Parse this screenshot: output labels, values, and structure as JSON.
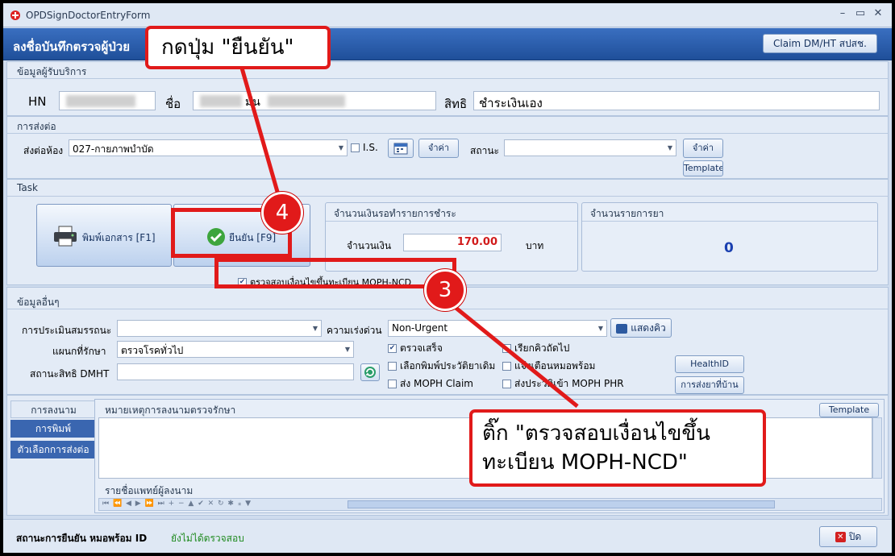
{
  "window": {
    "title": "OPDSignDoctorEntryForm",
    "controls": {
      "minimize": "–",
      "maximize": "▭",
      "close": "✕"
    }
  },
  "header": {
    "title": "ลงชื่อบันทึกตรวจผู้ป่วย",
    "claim_button": "Claim DM/HT สปสช."
  },
  "patient": {
    "section_title": "ข้อมูลผู้รับบริการ",
    "hn_label": "HN",
    "name_label": "ชื่อ",
    "name_value": "มัน",
    "right_label": "สิทธิ",
    "right_value": "ชำระเงินเอง"
  },
  "referral": {
    "section_title": "การส่งต่อ",
    "room_label": "ส่งต่อห้อง",
    "room_value": "027-กายภาพบำบัด",
    "is_label": "I.S.",
    "remember_button": "จำค่า",
    "status_label": "สถานะ",
    "status_value": "",
    "remember_button2": "จำค่า",
    "template_button": "Template"
  },
  "task": {
    "section_title": "Task",
    "print_button": "พิมพ์เอกสาร [F1]",
    "confirm_button": "ยืนยัน [F9]",
    "ncd_checkbox": "ตรวจสอบเงื่อนไขขึ้นทะเบียน MOPH-NCD",
    "ncd_checked": true,
    "payment_panel_title": "จำนวนเงินรอทำรายการชำระ",
    "amount_label": "จำนวนเงิน",
    "amount_value": "170.00",
    "currency": "บาท",
    "drug_panel_title": "จำนวนรายการยา",
    "drug_count": "0"
  },
  "other": {
    "section_title": "ข้อมูลอื่นๆ",
    "assessment_label": "การประเมินสมรรถนะ",
    "assessment_value": "",
    "urgency_label": "ความเร่งด่วน",
    "urgency_value": "Non-Urgent",
    "show_queue_button": "แสดงคิว",
    "dept_label": "แผนกที่รักษา",
    "dept_value": "ตรวจโรคทั่วไป",
    "dmht_label": "สถานะสิทธิ DMHT",
    "dmht_value": "",
    "checks": [
      {
        "label": "ตรวจเสร็จ",
        "checked": true
      },
      {
        "label": "เรียกคิวถัดไป",
        "checked": false
      },
      {
        "label": "เลือกพิมพ์ประวัติยาเดิม",
        "checked": false
      },
      {
        "label": "แจ้งเตือนหมอพร้อม",
        "checked": false
      },
      {
        "label": "ส่ง MOPH Claim",
        "checked": false
      },
      {
        "label": "ส่งประวัติเข้า MOPH PHR",
        "checked": false
      }
    ],
    "healthid_button": "HealthID",
    "send_drug_home_button": "การส่งยาที่บ้าน"
  },
  "tabs": [
    "การลงนาม",
    "การพิมพ์",
    "ตัวเลือกการส่งต่อ"
  ],
  "notes": {
    "title": "หมายเหตุการลงนามตรวจรักษา",
    "template_button": "Template",
    "doctor_list_title": "รายชื่อแพทย์ผู้ลงนาม",
    "nav_symbols": "⏮ ⏪ ◀ ▶ ⏩ ⏭ + − ▲ ✔ ✕ ↻ ✱ ⁎ ▼"
  },
  "status": {
    "label": "สถานะการยืนยัน หมอพร้อม ID",
    "value": "ยังไม่ได้ตรวจสอบ",
    "close_button": "ปิด"
  },
  "annotations": {
    "callout_top": "กดปุ่ม \"ยืนยัน\"",
    "callout_bottom_line1": "ติ๊ก \"ตรวจสอบเงื่อนไขขึ้น",
    "callout_bottom_line2": "ทะเบียน MOPH-NCD\"",
    "step4": "4",
    "step3": "3"
  },
  "colors": {
    "header_blue": "#2a5ca8",
    "annotation_red": "#e11a1a",
    "amount_red": "#d11a1a",
    "count_blue": "#1a3fb0",
    "status_green": "#1f8a1f"
  }
}
